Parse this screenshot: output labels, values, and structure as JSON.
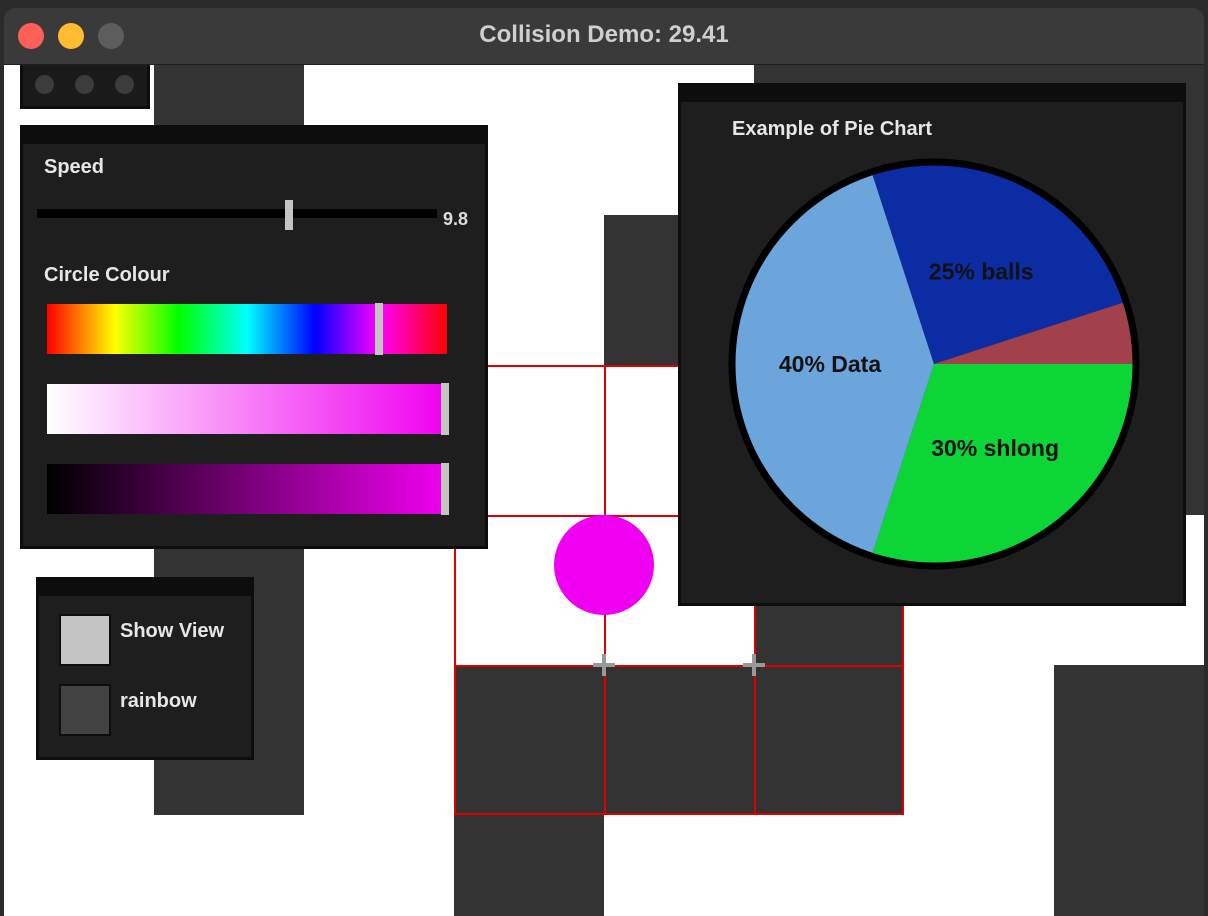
{
  "window": {
    "title": "Collision Demo: 29.41"
  },
  "icons": {
    "close": "red-traffic-light-icon",
    "minimize": "yellow-traffic-light-icon",
    "maximize": "gray-traffic-light-icon"
  },
  "controls_panel": {
    "speed_label": "Speed",
    "speed_value": "9.8",
    "speed_fraction": 0.63,
    "colour_label": "Circle Colour",
    "hue_fraction": 0.83,
    "saturation_fraction": 1.0,
    "value_fraction": 1.0,
    "selected_colour": "#f000f0"
  },
  "toggles_panel": {
    "show_view_label": "Show View",
    "show_view_checked": true,
    "rainbow_label": "rainbow",
    "rainbow_checked": false
  },
  "chart_data": {
    "type": "pie",
    "title": "Example of Pie Chart",
    "slices": [
      {
        "label": "30% shlong",
        "value": 30,
        "color": "#0cd635"
      },
      {
        "label": "40% Data",
        "value": 40,
        "color": "#6ba5dc"
      },
      {
        "label": "25% balls",
        "value": 25,
        "color": "#0c2ca3"
      },
      {
        "label": "",
        "value": 5,
        "color": "#a2404c"
      }
    ]
  },
  "colors": {
    "tile": "#333333",
    "collision_outline": "#e00000",
    "ball": "#f000f0"
  }
}
